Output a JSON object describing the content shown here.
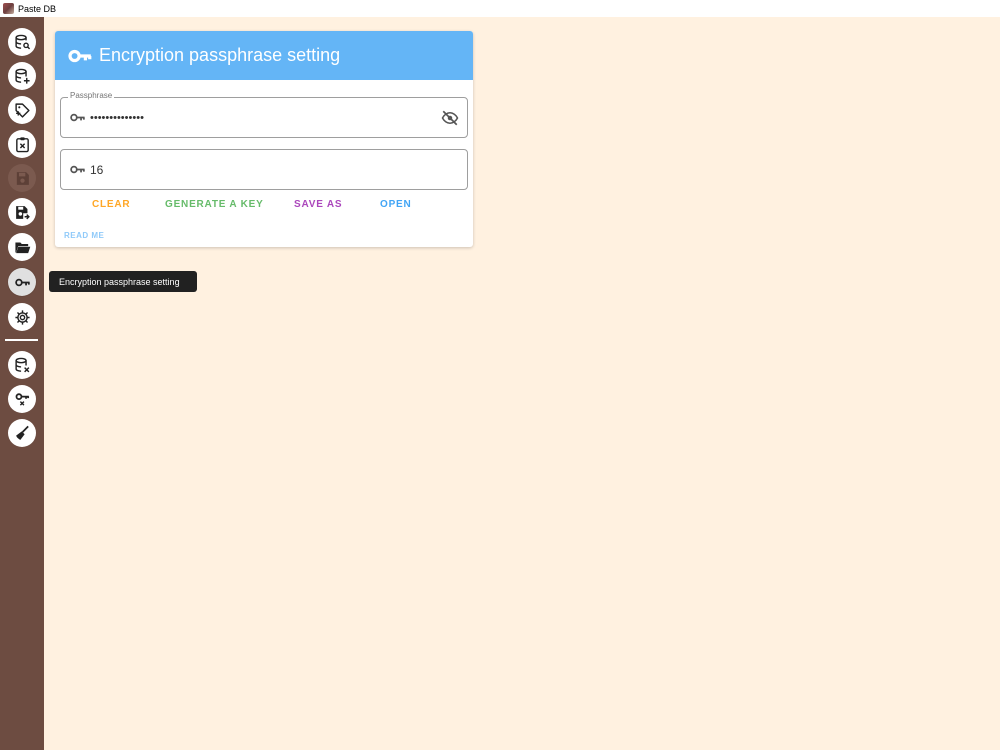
{
  "window": {
    "title": "Paste DB"
  },
  "sidebar": {
    "buttons": [
      {
        "name": "search-db",
        "icon": "database-search-icon"
      },
      {
        "name": "add-db",
        "icon": "database-plus-icon"
      },
      {
        "name": "add-tag",
        "icon": "tag-plus-icon"
      },
      {
        "name": "clipboard-remove",
        "icon": "clipboard-remove-icon"
      },
      {
        "name": "save",
        "icon": "save-icon",
        "disabled": true
      },
      {
        "name": "save-as",
        "icon": "save-as-icon"
      },
      {
        "name": "open",
        "icon": "folder-open-icon"
      },
      {
        "name": "encryption",
        "icon": "key-icon",
        "active": true
      },
      {
        "name": "settings",
        "icon": "gear-icon"
      },
      {
        "name": "remove-db",
        "icon": "database-remove-icon"
      },
      {
        "name": "remove-key",
        "icon": "key-remove-icon"
      },
      {
        "name": "clean",
        "icon": "broom-icon"
      }
    ]
  },
  "card": {
    "title": "Encryption passphrase setting",
    "passphrase": {
      "label": "Passphrase",
      "value": "••••••••••••••"
    },
    "key_length": {
      "value": "16"
    },
    "actions": {
      "clear": "CLEAR",
      "generate": "GENERATE A KEY",
      "save_as": "SAVE AS",
      "open": "OPEN"
    },
    "read_me": "READ ME"
  },
  "tooltip": {
    "text": "Encryption passphrase setting"
  },
  "colors": {
    "sidebar": "#6d4c41",
    "background": "#fff1e0",
    "header": "#64b5f6",
    "clear": "#ffa726",
    "generate": "#66bb6a",
    "save_as": "#ab47bc",
    "open": "#42a5f5",
    "read_me": "#90caf9"
  }
}
